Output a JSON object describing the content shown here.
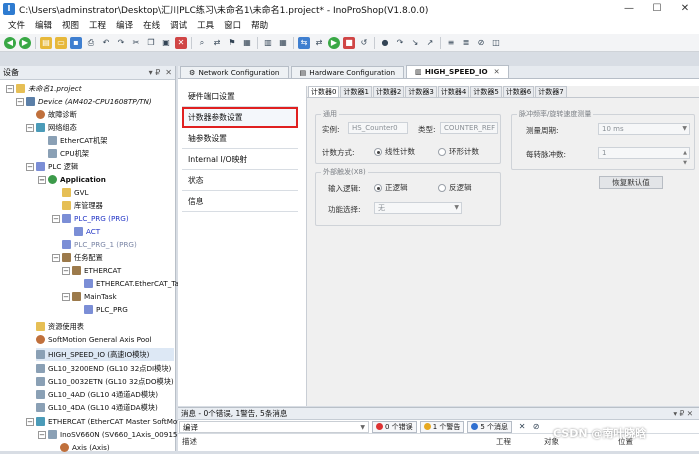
{
  "window": {
    "title": "C:\\Users\\adminstrator\\Desktop\\汇川PLC练习\\未命名1\\未命名1.project* - InoProShop(V1.8.0.0)",
    "minimize": "—",
    "maximize": "☐",
    "close": "✕"
  },
  "menu": [
    "文件",
    "编辑",
    "视图",
    "工程",
    "编译",
    "在线",
    "调试",
    "工具",
    "窗口",
    "帮助"
  ],
  "device_panel": {
    "title": "设备",
    "pin": "▾ ₽",
    "close": "✕"
  },
  "tree": [
    {
      "label": "未命名1.project"
    },
    {
      "label": "Device (AM402-CPU1608TP/TN)"
    },
    {
      "label": "故障诊断"
    },
    {
      "label": "网络组态"
    },
    {
      "label": "EtherCAT机架"
    },
    {
      "label": "CPU机架"
    },
    {
      "label": "PLC 逻辑"
    },
    {
      "label": "Application"
    },
    {
      "label": "GVL"
    },
    {
      "label": "库管理器"
    },
    {
      "label": "PLC_PRG (PRG)"
    },
    {
      "label": "ACT"
    },
    {
      "label": "PLC_PRG_1 (PRG)"
    },
    {
      "label": "任务配置"
    },
    {
      "label": "ETHERCAT"
    },
    {
      "label": "ETHERCAT.EtherCAT_Tas"
    },
    {
      "label": "MainTask"
    },
    {
      "label": "PLC_PRG"
    },
    {
      "label": "资源使用表"
    },
    {
      "label": "SoftMotion General Axis Pool"
    },
    {
      "label": "HIGH_SPEED_IO (高速IO模块)"
    },
    {
      "label": "GL10_3200END (GL10 32点DI模块)"
    },
    {
      "label": "GL10_0032ETN (GL10 32点DO模块)"
    },
    {
      "label": "GL10_4AD (GL10 4通道AD模块)"
    },
    {
      "label": "GL10_4DA (GL10 4通道DA模块)"
    },
    {
      "label": "ETHERCAT (EtherCAT Master SoftMotion)"
    },
    {
      "label": "InoSV660N (SV660_1Axis_00915)"
    },
    {
      "label": "Axis (Axis)"
    }
  ],
  "editor_tabs": [
    {
      "label": "Network Configuration"
    },
    {
      "label": "Hardware Configuration"
    },
    {
      "label": "HIGH_SPEED_IO"
    }
  ],
  "side_nav": [
    {
      "label": "硬件端口设置"
    },
    {
      "label": "计数器参数设置"
    },
    {
      "label": "轴参数设置"
    },
    {
      "label": "Internal I/O映射"
    },
    {
      "label": "状态"
    },
    {
      "label": "信息"
    }
  ],
  "counter_tabs": [
    "计数器0",
    "计数器1",
    "计数器2",
    "计数器3",
    "计数器4",
    "计数器5",
    "计数器6",
    "计数器7"
  ],
  "general": {
    "title": "通用",
    "instance_label": "实例:",
    "instance_value": "HS_Counter0",
    "type_label": "类型:",
    "type_value": "COUNTER_REF",
    "mode_label": "计数方式:",
    "mode_linear": "线性计数",
    "mode_ring": "环形计数"
  },
  "ext_input": {
    "title": "外部触发(X8)",
    "input_logic_label": "输入逻辑:",
    "logic_pos": "正逻辑",
    "logic_neg": "反逻辑",
    "func_label": "功能选择:",
    "func_value": "无"
  },
  "freq": {
    "title": "脉冲频率/旋转速度测量",
    "period_label": "测量周期:",
    "period_value": "10 ms",
    "ppr_label": "每转脉冲数:",
    "ppr_value": "1",
    "restore_button": "恢复默认值"
  },
  "messages": {
    "title": "消息 - 0个错误, 1警告, 5条消息",
    "pin": "▾ ₽ ✕",
    "filter": "编译",
    "errors": "0 个错误",
    "warnings": "1 个警告",
    "infos": "5 个消息",
    "col_desc": "描述",
    "col_project": "工程",
    "col_object": "对象",
    "col_pos": "位置"
  },
  "watermark": "CSDN @南叶晓晗",
  "colors": {
    "highlight": "#e02020",
    "link_blue": "#2336c6"
  }
}
